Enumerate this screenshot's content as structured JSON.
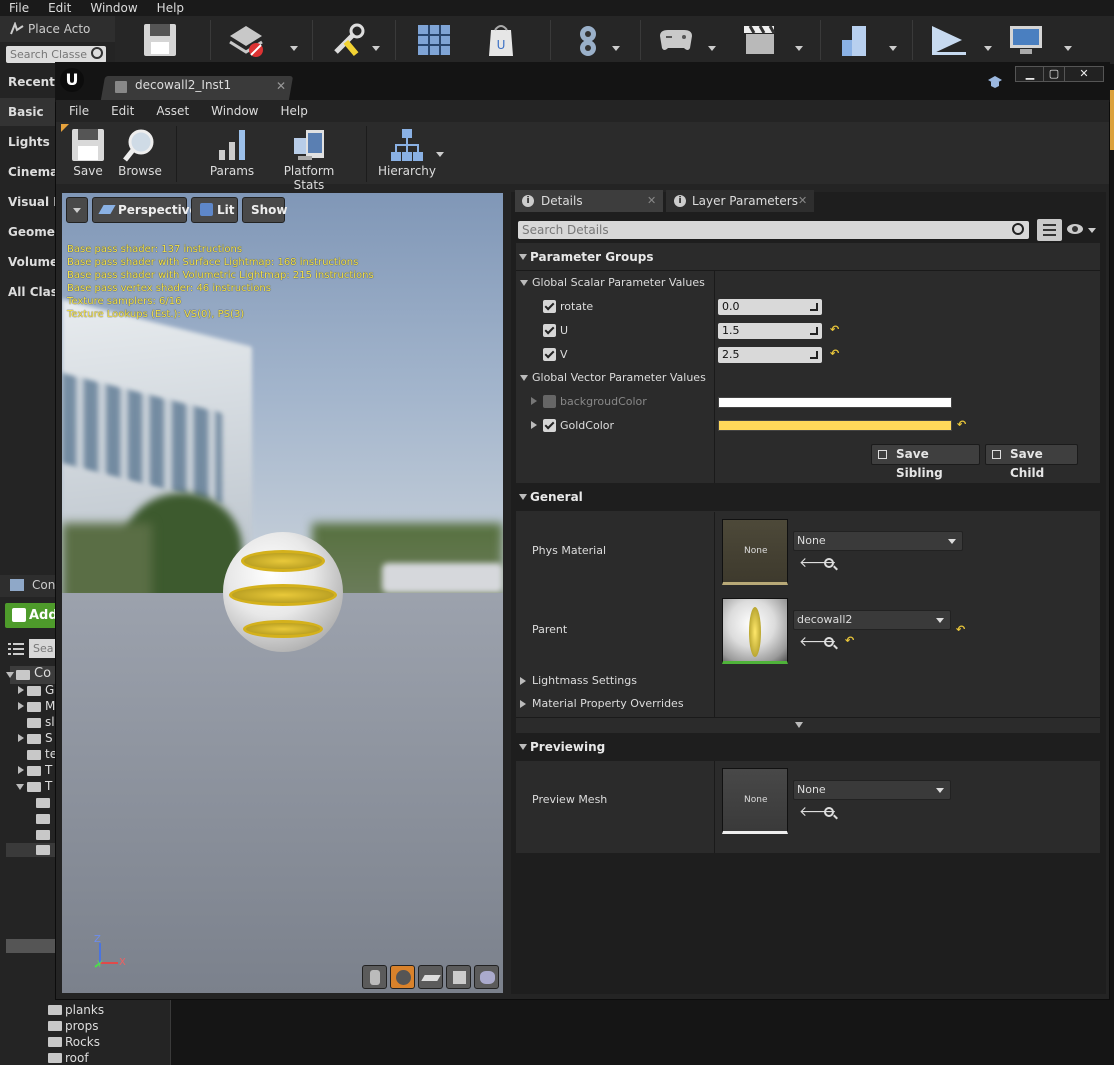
{
  "bg_editor": {
    "menu": [
      "File",
      "Edit",
      "Window",
      "Help"
    ],
    "place_actors_tab": "Place Acto",
    "search_placeholder": "Search Classe",
    "categories": [
      "Recently",
      "Basic",
      "Lights",
      "Cinemat",
      "Visual Ef",
      "Geomet",
      "Volumes",
      "All Class"
    ],
    "content_tab": "Con",
    "add_label": "Add",
    "content_search": "Sea",
    "tree_root": "Co",
    "tree_items": [
      "G",
      "M",
      "sl",
      "S",
      "te",
      "T",
      "T"
    ],
    "folders": [
      "planks",
      "props",
      "Rocks",
      "roof"
    ]
  },
  "window": {
    "doc_tab": "decowall2_Inst1",
    "menu": [
      "File",
      "Edit",
      "Asset",
      "Window",
      "Help"
    ],
    "toolbar": {
      "save": "Save",
      "browse": "Browse",
      "params": "Params",
      "platform_stats": "Platform Stats",
      "hierarchy": "Hierarchy"
    }
  },
  "viewport": {
    "perspective": "Perspective",
    "lit": "Lit",
    "show": "Show",
    "stats": [
      "Base pass shader: 137 instructions",
      "Base pass shader with Surface Lightmap: 168 instructions",
      "Base pass shader with Volumetric Lightmap: 215 instructions",
      "Base pass vertex shader: 46 instructions",
      "Texture samplers: 6/16",
      "Texture Lookups (Est.): VS(0), PS(3)"
    ],
    "axis_z": "Z",
    "axis_x": "X",
    "axis_y": "Y"
  },
  "details": {
    "tab_details": "Details",
    "tab_layer": "Layer Parameters",
    "search_placeholder": "Search Details",
    "parameter_groups": "Parameter Groups",
    "scalar_group": "Global Scalar Parameter Values",
    "scalars": [
      {
        "name": "rotate",
        "value": "0.0"
      },
      {
        "name": "U",
        "value": "1.5"
      },
      {
        "name": "V",
        "value": "2.5"
      }
    ],
    "vector_group": "Global Vector Parameter Values",
    "vectors": [
      {
        "name": "backgroudColor",
        "color": "#ffffff"
      },
      {
        "name": "GoldColor",
        "color": "#ffd85a"
      }
    ],
    "save_sibling": "Save Sibling",
    "save_child": "Save Child",
    "general": "General",
    "phys_material": "Phys Material",
    "phys_material_thumb": "None",
    "phys_material_value": "None",
    "parent": "Parent",
    "parent_value": "decowall2",
    "lightmass": "Lightmass Settings",
    "overrides": "Material Property Overrides",
    "previewing": "Previewing",
    "preview_mesh": "Preview Mesh",
    "preview_thumb": "None",
    "preview_value": "None"
  }
}
